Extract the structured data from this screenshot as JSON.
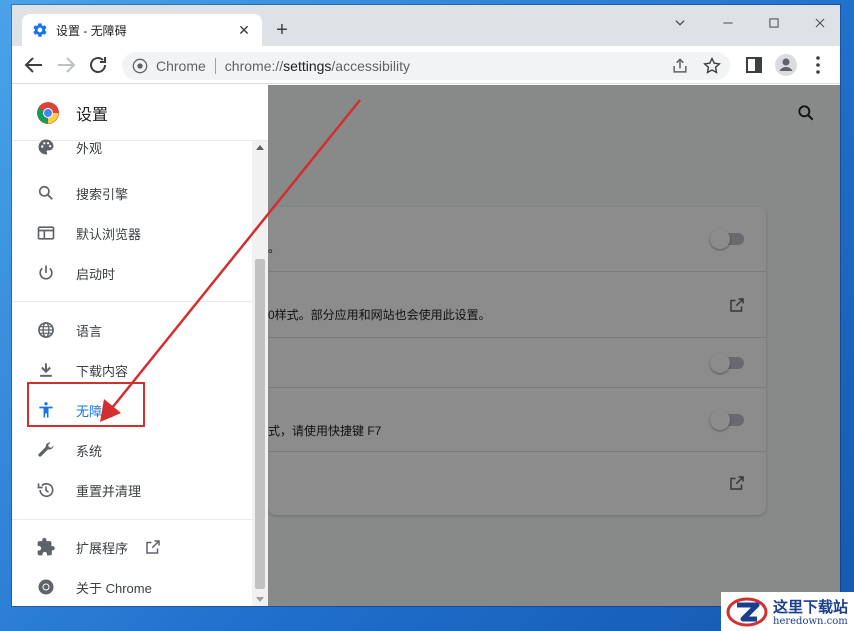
{
  "tab": {
    "title": "设置 - 无障碍",
    "close_glyph": "✕",
    "icon": "gear-icon"
  },
  "window_controls": {
    "collapse": "⌄",
    "minimize": "—",
    "maximize": "☐",
    "close": "✕"
  },
  "new_tab_label": "+",
  "omnibox": {
    "site_label": "Chrome",
    "url_scheme": "chrome://",
    "url_host": "settings",
    "url_path": "/accessibility"
  },
  "drawer": {
    "title": "设置",
    "items": [
      {
        "label": "外观",
        "icon": "palette-icon"
      },
      {
        "label": "搜索引擎",
        "icon": "search-icon"
      },
      {
        "label": "默认浏览器",
        "icon": "browser-icon"
      },
      {
        "label": "启动时",
        "icon": "power-icon"
      },
      {
        "label": "语言",
        "icon": "globe-icon"
      },
      {
        "label": "下载内容",
        "icon": "download-icon"
      },
      {
        "label": "无障碍",
        "icon": "accessibility-icon"
      },
      {
        "label": "系统",
        "icon": "wrench-icon"
      },
      {
        "label": "重置并清理",
        "icon": "history-icon"
      },
      {
        "label": "扩展程序",
        "icon": "puzzle-icon"
      },
      {
        "label": "关于 Chrome",
        "icon": "chrome-icon"
      }
    ],
    "active_item": "无障碍"
  },
  "card": {
    "rows": [
      {
        "text": "。",
        "control": "toggle"
      },
      {
        "text": "0样式。部分应用和网站也会使用此设置。",
        "control": "external-link"
      },
      {
        "text": "",
        "control": "toggle"
      },
      {
        "text": "式，请使用快捷键 F7",
        "control": "toggle"
      },
      {
        "text": "",
        "control": "external-link"
      }
    ]
  },
  "annotation": {
    "highlight_color": "#d32f2f",
    "arrow_color": "#d32f2f"
  },
  "watermark": {
    "cn": "这里下载站",
    "en": "heredown.com"
  },
  "colors": {
    "accent": "#1a73e8",
    "desktop": "#1f6fcc"
  }
}
